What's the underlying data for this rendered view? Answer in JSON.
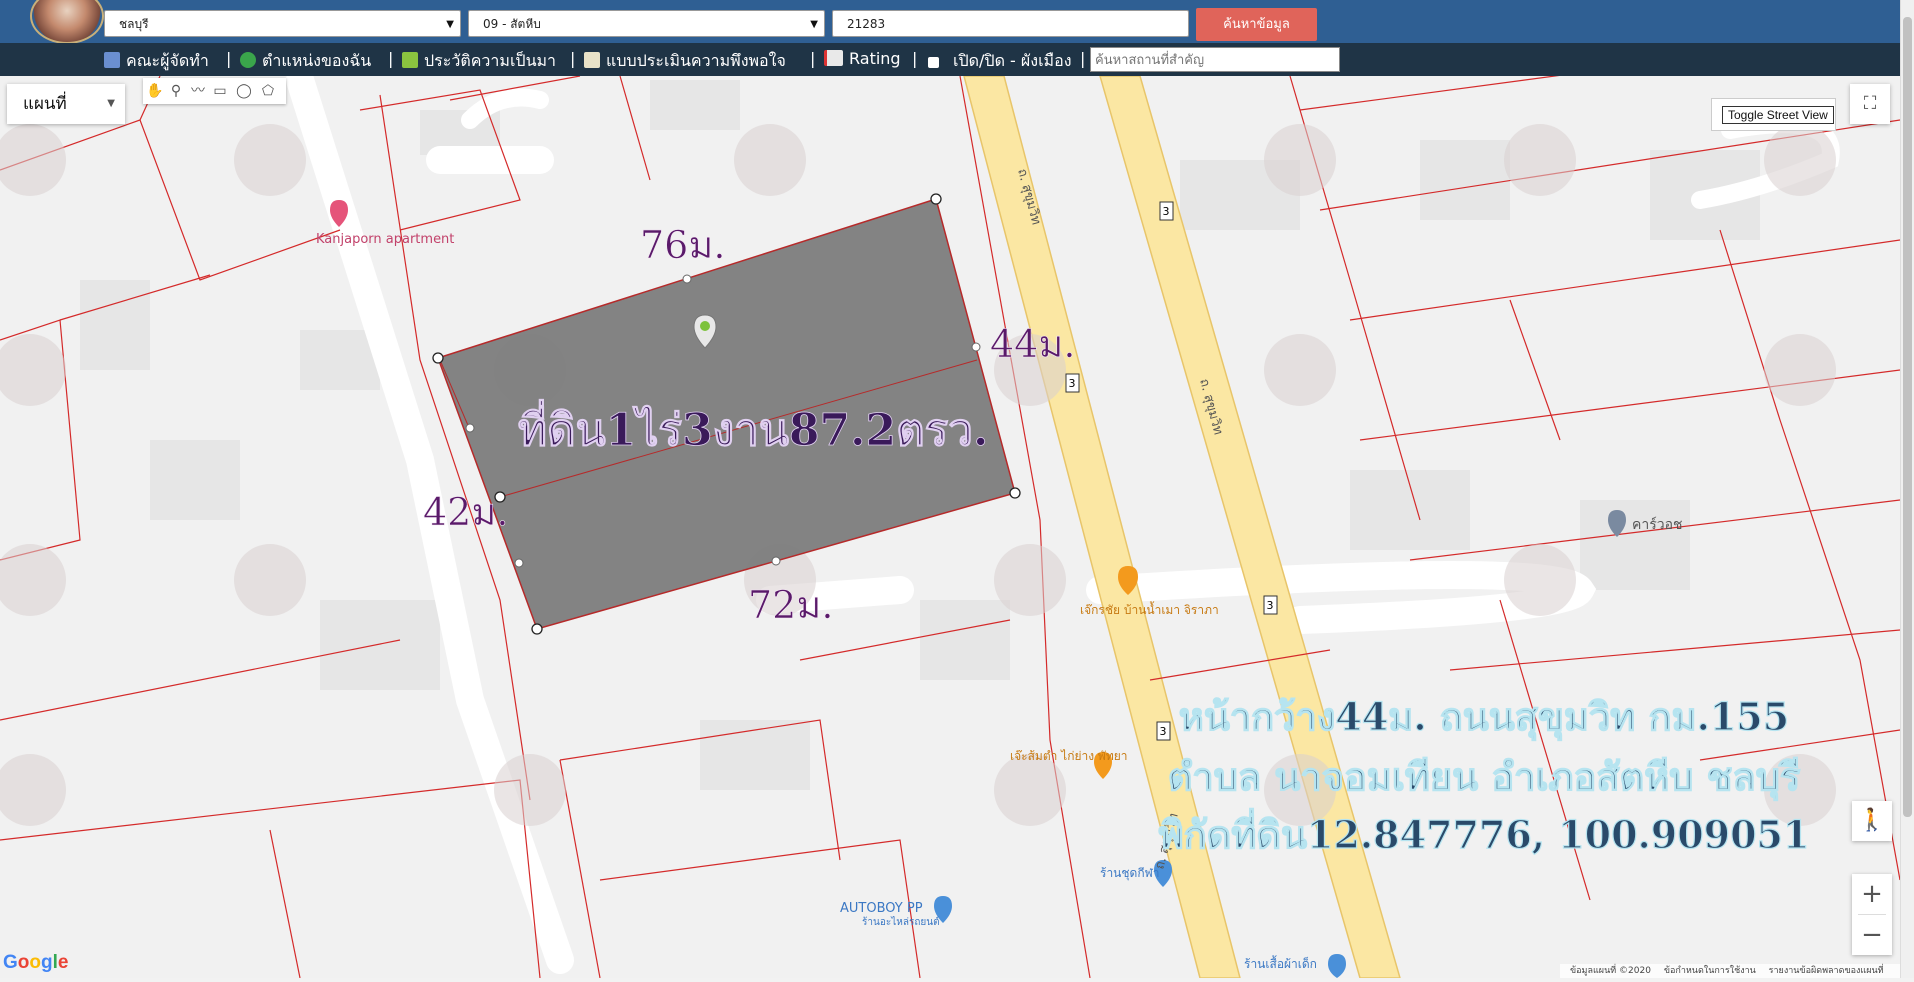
{
  "topbar": {
    "province": "ชลบุรี",
    "district": "09 - สัตหีบ",
    "parcel_number": "21283",
    "search_button": "ค้นหาข้อมูล"
  },
  "nav": {
    "items": [
      {
        "label": "คณะผู้จัดทำ",
        "icon": "team-icon"
      },
      {
        "label": "ตำแหน่งของฉัน",
        "icon": "globe-icon"
      },
      {
        "label": "ประวัติความเป็นมา",
        "icon": "sprout-icon"
      },
      {
        "label": "แบบประเมินความพึงพอใจ",
        "icon": "form-icon"
      },
      {
        "label": "Rating",
        "icon": "chart-icon"
      },
      {
        "label": "เปิด/ปิด - ผังเมือง",
        "icon": "checkbox-icon"
      }
    ],
    "separator": "|",
    "place_search_placeholder": "ค้นหาสถานที่สำคัญ"
  },
  "map_controls": {
    "map_type": "แผนที่",
    "toggle_street_view": "Toggle Street View",
    "zoom_in": "+",
    "zoom_out": "−",
    "fullscreen": "⛶",
    "pegman": "🚶",
    "google_logo": [
      "G",
      "o",
      "o",
      "g",
      "l",
      "e"
    ],
    "google_colors": [
      "#4285F4",
      "#EA4335",
      "#FBBC05",
      "#4285F4",
      "#34A853",
      "#EA4335"
    ],
    "footer": [
      "ข้อมูลแผนที่ ©2020",
      "ข้อกำหนดในการใช้งาน",
      "รายงานข้อผิดพลาดของแผนที่"
    ]
  },
  "parcel": {
    "area_label": "ที่ดิน1ไร่3งาน87.2ตรว.",
    "sides": {
      "top": "76ม.",
      "right": "44ม.",
      "left": "42ม.",
      "bottom": "72ม."
    },
    "fill_color": "#7a7a7a"
  },
  "map_labels": {
    "kanjaporn": "Kanjaporn apartment",
    "carwash": "คาร์วอช",
    "restaurant": "เจ๊กรชัย บ้านน้ำเมา จิราภา",
    "chicken": "เจ๊ะส้มตำ ไก่ย่าง พัทยา",
    "shoe_shop": "ร้านชุดกีฬา",
    "autoboy": "AUTOBOY PP",
    "autoboy_sub": "ร้านอะไหล่รถยนต์",
    "kids_shop": "ร้านเสื้อผ้าเด็ก",
    "road_left": "ถ. สุขุมวิท",
    "road_right": "ถ. สุขุมวิท",
    "road_bottom": "ถ. สุขุมวิท",
    "route_number": "3"
  },
  "overlay": {
    "line1": "หน้ากว้าง44ม. ถนนสุขุมวิท กม.155",
    "line2": "ตำบล นาจอมเทียน อำเภอสัตหีบ ชลบุรี",
    "line3": "พิกัดที่ดิน12.847776, 100.909051"
  }
}
